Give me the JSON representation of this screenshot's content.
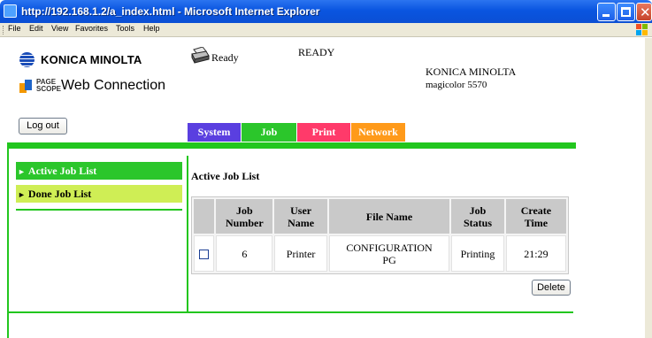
{
  "window": {
    "title": "http://192.168.1.2/a_index.html - Microsoft Internet Explorer",
    "icon": "ie-icon"
  },
  "menu": {
    "items": [
      "File",
      "Edit",
      "View",
      "Favorites",
      "Tools",
      "Help"
    ]
  },
  "header": {
    "brand": "KONICA MINOLTA",
    "pagescope_small_1": "PAGE",
    "pagescope_small_2": "SCOPE",
    "web_connection": "Web Connection",
    "status_text": "Ready",
    "status_caps": "READY",
    "device_maker": "KONICA MINOLTA",
    "device_model": "magicolor 5570",
    "logout_label": "Log out"
  },
  "tabs": [
    {
      "label": "System",
      "color": "#5a3fe0"
    },
    {
      "label": "Job",
      "color": "#2bc62b",
      "selected": true
    },
    {
      "label": "Print",
      "color": "#ff3a6a"
    },
    {
      "label": "Network",
      "color": "#ff9a1a"
    }
  ],
  "sidebar": {
    "items": [
      {
        "label": "Active Job List",
        "selected": true
      },
      {
        "label": "Done Job List",
        "selected": false
      }
    ]
  },
  "main": {
    "section_title": "Active Job List",
    "table": {
      "headers": [
        {
          "line1": "",
          "line2": ""
        },
        {
          "line1": "Job",
          "line2": "Number"
        },
        {
          "line1": "User",
          "line2": "Name"
        },
        {
          "line1": "File Name",
          "line2": ""
        },
        {
          "line1": "Job",
          "line2": "Status"
        },
        {
          "line1": "Create",
          "line2": "Time"
        }
      ],
      "rows": [
        {
          "checked": false,
          "job_number": "6",
          "user_name": "Printer",
          "file_name_line1": "CONFIGURATION",
          "file_name_line2": "PG",
          "job_status": "Printing",
          "create_time": "21:29"
        }
      ]
    },
    "delete_label": "Delete"
  },
  "colors": {
    "accent_green": "#22c61e",
    "done_item": "#cfee55",
    "titlebar_blue": "#0a55e0"
  }
}
